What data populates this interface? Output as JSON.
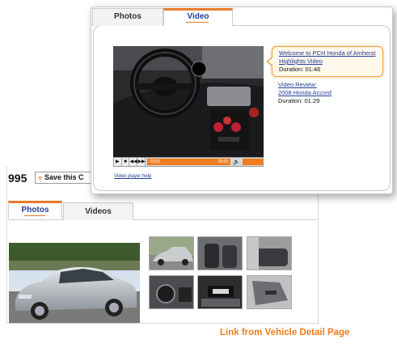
{
  "vehicle_page": {
    "price_fragment": "995",
    "save_button_label": "Save this C",
    "tabs": [
      {
        "label": "Photos"
      },
      {
        "label": "Videos"
      }
    ],
    "main_photo_icon": "silver-sedan-photo",
    "thumbnails": [
      {
        "icon": "sedan-exterior-thumb"
      },
      {
        "icon": "interior-seats-thumb"
      },
      {
        "icon": "rear-seats-thumb"
      },
      {
        "icon": "dashboard-thumb"
      },
      {
        "icon": "engine-bay-thumb"
      },
      {
        "icon": "door-panel-thumb"
      }
    ]
  },
  "video_popup": {
    "tabs": [
      {
        "label": "Photos"
      },
      {
        "label": "Video"
      }
    ],
    "player": {
      "current_time": "00:00",
      "end_time": "00:00",
      "help_link": "Video player help",
      "accent_color": "#f07d1d"
    },
    "playlist": [
      {
        "title_line1": "Welcome to PCH Honda of Amherst",
        "title_line2": "Highlights Video",
        "duration": "Duration: 01:46"
      },
      {
        "title_line1": "Video Review:",
        "title_line2": "2008 Honda Accord",
        "duration": "Duration: 01:29"
      }
    ]
  },
  "caption": "Link from Vehicle Detail Page"
}
